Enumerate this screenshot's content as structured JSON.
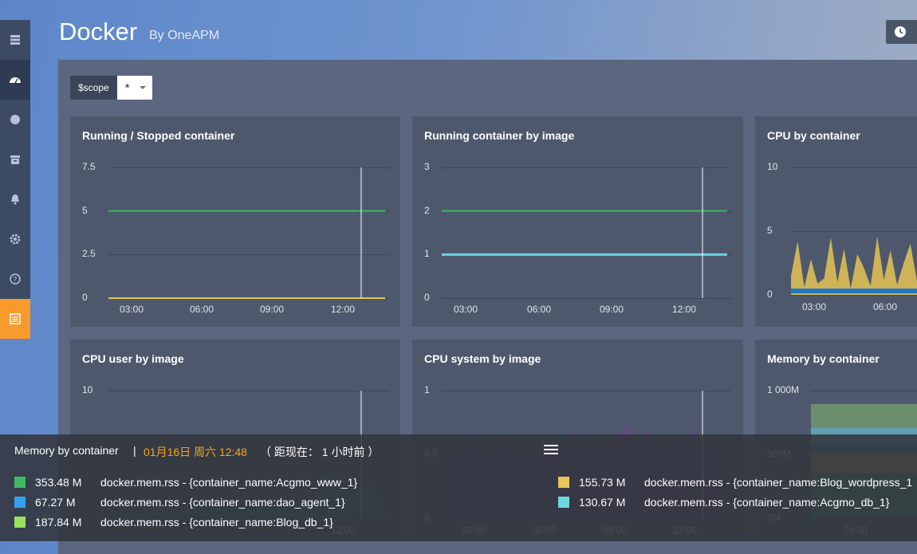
{
  "header": {
    "title": "Docker",
    "subtitle": "By OneAPM"
  },
  "sidebar": {
    "items": [
      {
        "icon": "server-icon"
      },
      {
        "icon": "dashboard-icon"
      },
      {
        "icon": "circle-icon"
      },
      {
        "icon": "archive-icon"
      },
      {
        "icon": "bell-icon"
      },
      {
        "icon": "gear-icon"
      },
      {
        "icon": "help-icon"
      },
      {
        "icon": "list-icon"
      }
    ]
  },
  "scope": {
    "label": "$scope",
    "value": "*"
  },
  "colors": {
    "green": "#3dbb61",
    "cyan": "#6ed0e0",
    "yellow": "#e5c454",
    "blue": "#1f78c1",
    "purple": "#614d7d",
    "lime": "#7eb26d",
    "accent": "#f89a2c"
  },
  "panels": [
    {
      "title": "Running / Stopped container",
      "yticks": [
        "7.5",
        "5",
        "2.5",
        "0"
      ],
      "xticks": [
        "03:00",
        "06:00",
        "09:00",
        "12:00"
      ]
    },
    {
      "title": "Running container by image",
      "yticks": [
        "3",
        "2",
        "1",
        "0"
      ],
      "xticks": [
        "03:00",
        "06:00",
        "09:00",
        "12:00"
      ]
    },
    {
      "title": "CPU by container",
      "yticks": [
        "10",
        "5",
        "0"
      ],
      "xticks": [
        "03:00",
        "06:00"
      ]
    },
    {
      "title": "CPU user by image",
      "yticks": [
        "10"
      ],
      "xticks": [
        "12:00"
      ]
    },
    {
      "title": "CPU system by image",
      "yticks": [
        "1",
        "0.5",
        "0"
      ],
      "xticks": [
        "03:00",
        "06:00",
        "09:00",
        "12:00"
      ]
    },
    {
      "title": "Memory by container",
      "yticks": [
        "1 000M",
        "500M",
        "0M"
      ],
      "xticks": [
        "04:00"
      ]
    }
  ],
  "chart_data": [
    {
      "type": "line",
      "title": "Running / Stopped container",
      "x": [
        "03:00",
        "06:00",
        "09:00",
        "12:00"
      ],
      "ylim": [
        0,
        7.5
      ],
      "series": [
        {
          "values": [
            5,
            5,
            5,
            5
          ]
        },
        {
          "values": [
            0,
            0,
            0,
            0
          ]
        }
      ]
    },
    {
      "type": "line",
      "title": "Running container by image",
      "x": [
        "03:00",
        "06:00",
        "09:00",
        "12:00"
      ],
      "ylim": [
        0,
        3
      ],
      "series": [
        {
          "values": [
            2,
            2,
            2,
            2
          ]
        },
        {
          "values": [
            1,
            1,
            1,
            1
          ]
        }
      ]
    },
    {
      "type": "area",
      "title": "CPU by container",
      "x": [
        "03:00",
        "06:00"
      ],
      "ylim": [
        0,
        10
      ],
      "series": [
        {
          "values": [
            1.5,
            4.2,
            0.6,
            2.8,
            0.9,
            1.3,
            4.5,
            1.0,
            3.6,
            0.5,
            3.2,
            2.1,
            0.7,
            4.6,
            1.2,
            3.5,
            0.8,
            2.5,
            4.0,
            1.1
          ]
        }
      ]
    },
    {
      "type": "area",
      "title": "CPU user by image",
      "x": [
        "12:00"
      ],
      "ylim": [
        0,
        10
      ]
    },
    {
      "type": "area",
      "title": "CPU system by image",
      "x": [
        "03:00",
        "06:00",
        "09:00",
        "12:00"
      ],
      "ylim": [
        0,
        1
      ],
      "series": [
        {
          "values": [
            0.55,
            0.45,
            0.6,
            0.5,
            0.55,
            0.65,
            0.5,
            0.55,
            0.45,
            0.6,
            0.55,
            0.7,
            0.5,
            0.6,
            0.55,
            0.65,
            0.75,
            0.6,
            0.7,
            0.55,
            0.65,
            0.6,
            0.7,
            0.55,
            0.65,
            0.6
          ]
        }
      ]
    },
    {
      "type": "area",
      "title": "Memory by container",
      "x": [
        "04:00"
      ],
      "ylim": [
        0,
        1000
      ],
      "series": [
        {
          "name": "docker.mem.rss - {container_name:Acgmo_www_1}",
          "values": [
            353.48
          ]
        },
        {
          "name": "docker.mem.rss - {container_name:Blog_wordpress_1}",
          "values": [
            155.73
          ]
        },
        {
          "name": "docker.mem.rss - {container_name:dao_agent_1}",
          "values": [
            67.27
          ]
        },
        {
          "name": "docker.mem.rss - {container_name:Acgmo_db_1}",
          "values": [
            130.67
          ]
        },
        {
          "name": "docker.mem.rss - {container_name:Blog_db_1}",
          "values": [
            187.84
          ]
        }
      ]
    }
  ],
  "tooltip": {
    "title": "Memory by container",
    "separator": "|",
    "date": "01月16日 周六 12:48",
    "relative": "（ 距现在： 1 小时前 ）",
    "items": [
      {
        "color": "#3dbb61",
        "value": "353.48 M",
        "name": "docker.mem.rss - {container_name:Acgmo_www_1}"
      },
      {
        "color": "#35a0ef",
        "value": "67.27 M",
        "name": "docker.mem.rss - {container_name:dao_agent_1}"
      },
      {
        "color": "#9ae05a",
        "value": "187.84 M",
        "name": "docker.mem.rss - {container_name:Blog_db_1}"
      },
      {
        "color": "#e8c55b",
        "value": "155.73 M",
        "name": "docker.mem.rss - {container_name:Blog_wordpress_1"
      },
      {
        "color": "#6ed8e0",
        "value": "130.67 M",
        "name": "docker.mem.rss - {container_name:Acgmo_db_1}"
      }
    ]
  }
}
